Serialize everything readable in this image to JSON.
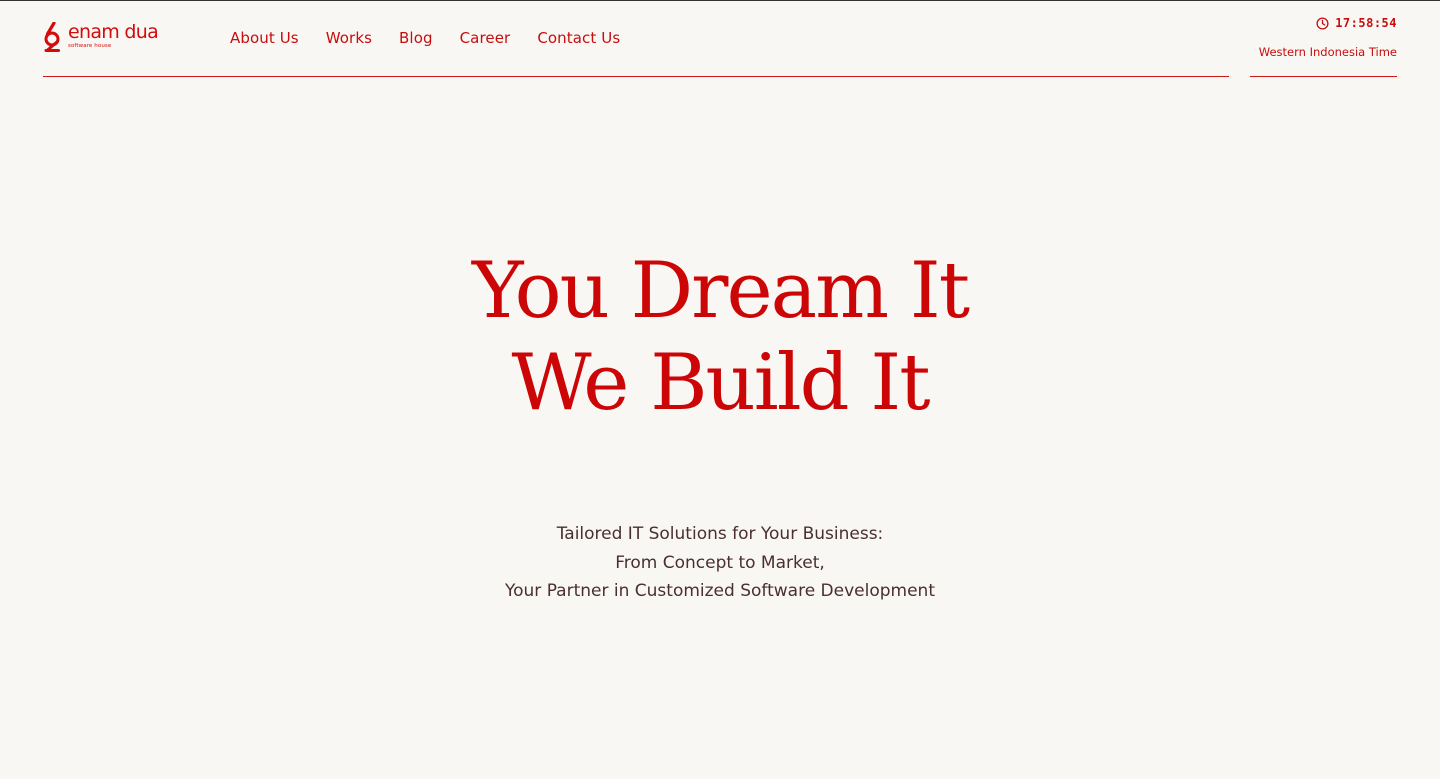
{
  "brand": {
    "name": "enam dua",
    "tagline": "software house",
    "color": "#d30b0b"
  },
  "nav": {
    "items": [
      {
        "label": "About Us"
      },
      {
        "label": "Works"
      },
      {
        "label": "Blog"
      },
      {
        "label": "Career"
      },
      {
        "label": "Contact Us"
      }
    ]
  },
  "clock": {
    "icon": "clock-icon",
    "time": "17:58:54",
    "timezone": "Western Indonesia Time"
  },
  "hero": {
    "line1": "You Dream It",
    "line2": "We Build It"
  },
  "subtitle": {
    "line1": "Tailored IT Solutions for Your Business:",
    "line2": "From Concept to Market,",
    "line3": "Your Partner in Customized Software Development"
  },
  "colors": {
    "accent": "#cc0606",
    "background": "#f9f7f4",
    "body_text": "#4a2f2f"
  }
}
